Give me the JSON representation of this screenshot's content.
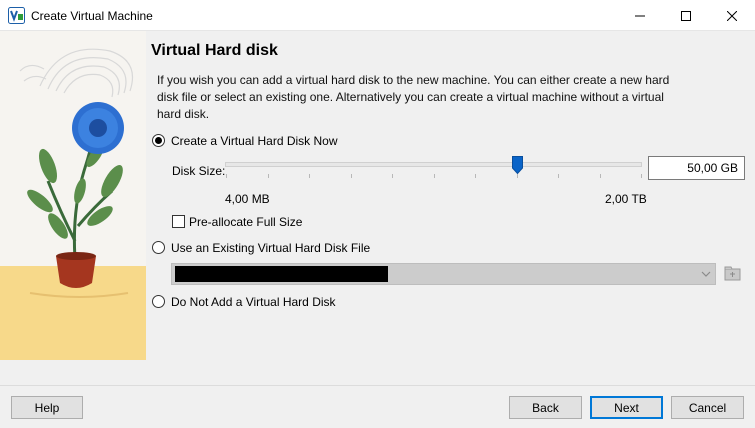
{
  "window": {
    "title": "Create Virtual Machine",
    "app_icon": "virtualbox-icon"
  },
  "page": {
    "heading": "Virtual Hard disk",
    "description": "If you wish you can add a virtual hard disk to the new machine. You can either create a new hard disk file or select an existing one. Alternatively you can create a virtual machine without a virtual hard disk."
  },
  "options": {
    "create_now": {
      "label": "Create a Virtual Hard Disk Now",
      "selected": true
    },
    "use_existing": {
      "label": "Use an Existing Virtual Hard Disk File",
      "selected": false
    },
    "do_not_add": {
      "label": "Do Not Add a Virtual Hard Disk",
      "selected": false
    }
  },
  "disk_size": {
    "label": "Disk Size:",
    "value": "50,00 GB",
    "min_label": "4,00 MB",
    "max_label": "2,00 TB",
    "slider_fraction": 0.7
  },
  "preallocate": {
    "label": "Pre-allocate Full Size",
    "checked": false
  },
  "existing_file": {
    "value_redacted": true,
    "enabled": false
  },
  "buttons": {
    "help": "Help",
    "back": "Back",
    "next": "Next",
    "cancel": "Cancel"
  },
  "colors": {
    "accent": "#0078d7",
    "slider_thumb": "#0a64c8"
  }
}
